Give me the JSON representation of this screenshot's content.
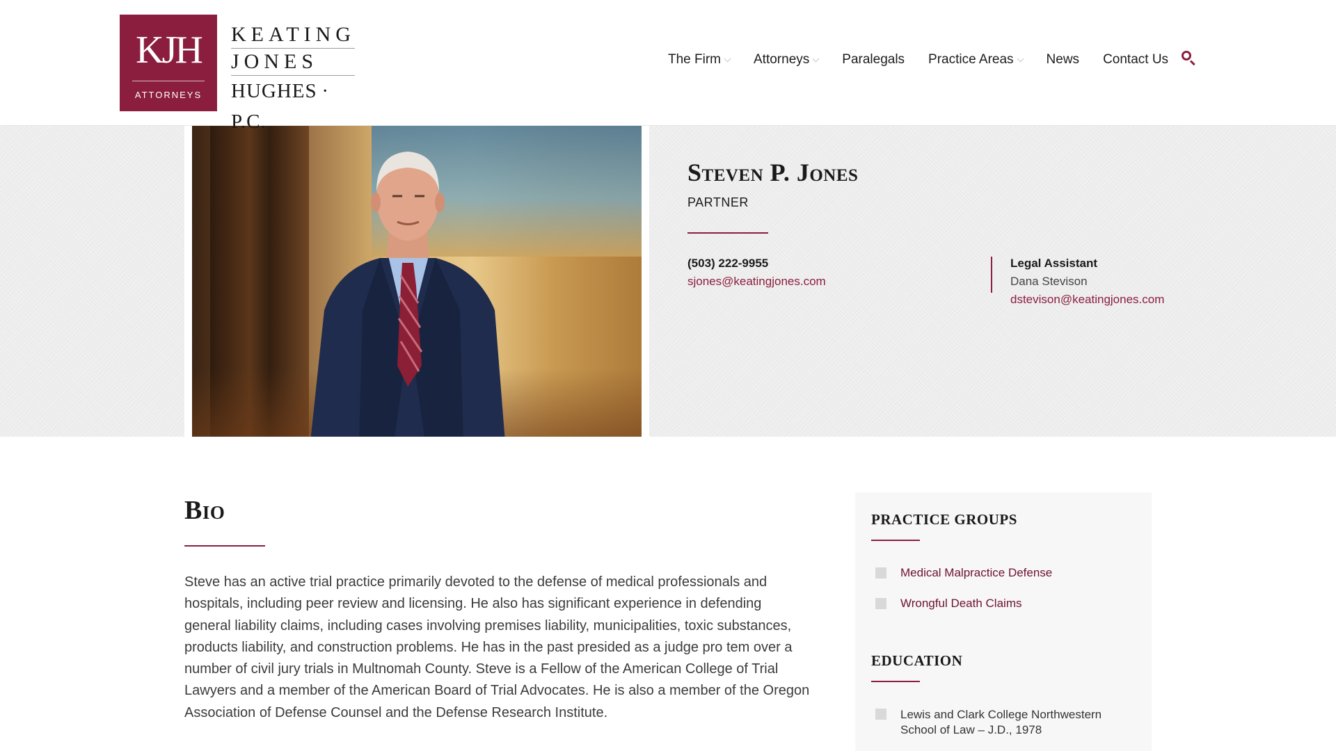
{
  "header": {
    "logo": {
      "mark": "KJH",
      "sub": "ATTORNEYS",
      "lines": [
        "KEATING",
        "JONES",
        "HUGHES · P.C."
      ]
    },
    "nav": [
      {
        "label": "The Firm",
        "dropdown": true
      },
      {
        "label": "Attorneys",
        "dropdown": true
      },
      {
        "label": "Paralegals",
        "dropdown": false
      },
      {
        "label": "Practice Areas",
        "dropdown": true
      },
      {
        "label": "News",
        "dropdown": false
      },
      {
        "label": "Contact Us",
        "dropdown": false
      }
    ],
    "search_icon": "search-icon"
  },
  "profile": {
    "name": "Steven P. Jones",
    "title": "PARTNER",
    "phone": "(503) 222-9955",
    "email": "sjones@keatingjones.com",
    "assistant": {
      "label": "Legal Assistant",
      "name": "Dana Stevison",
      "email": "dstevison@keatingjones.com"
    }
  },
  "bio": {
    "heading": "Bio",
    "text": "Steve has an active trial practice primarily devoted to the defense of medical professionals and hospitals, including peer review and licensing. He also has significant experience in defending general liability claims, including cases involving premises liability, municipalities, toxic substances, products liability, and construction problems. He has in the past presided as a judge pro tem over a number of civil jury trials in Multnomah County. Steve is a Fellow of the American College of Trial Lawyers and a member of the American Board of Trial Advocates. He is also a member of the Oregon Association of Defense Counsel and the Defense Research Institute."
  },
  "sidebar": {
    "practice_heading": "PRACTICE GROUPS",
    "practice_groups": [
      "Medical Malpractice Defense",
      "Wrongful Death Claims"
    ],
    "education_heading": "EDUCATION",
    "education": [
      "Lewis and Clark College Northwestern School of Law – J.D., 1978"
    ]
  },
  "colors": {
    "brand": "#8b1e3f",
    "link": "#6e1230"
  }
}
